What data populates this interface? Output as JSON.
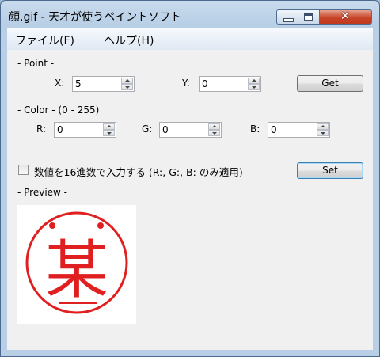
{
  "window": {
    "title": "顔.gif - 天才が使うペイントソフト",
    "controls": {
      "close_glyph": "✕"
    }
  },
  "menu": [
    {
      "label": "ファイル(F)"
    },
    {
      "label": "ヘルプ(H)"
    }
  ],
  "point": {
    "group_label": "- Point -",
    "x_label": "X:",
    "x_value": "5",
    "y_label": "Y:",
    "y_value": "0",
    "get_label": "Get"
  },
  "color": {
    "group_label": "- Color - (0 - 255)",
    "r_label": "R:",
    "r_value": "0",
    "g_label": "G:",
    "g_value": "0",
    "b_label": "B:",
    "b_value": "0"
  },
  "hex_checkbox": {
    "label": "数値を16進数で入力する (R:, G:, B: のみ適用)",
    "checked": false
  },
  "set_label": "Set",
  "preview": {
    "label": "- Preview -",
    "stamp_char": "某",
    "stamp_color": "#e02020"
  }
}
